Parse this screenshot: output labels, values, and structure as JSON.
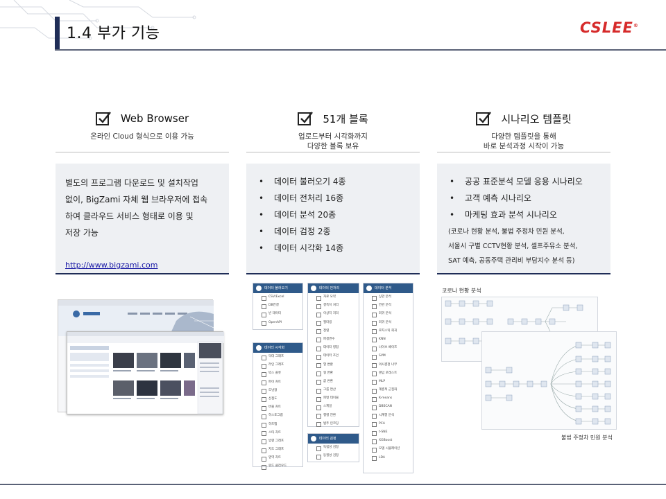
{
  "header": {
    "title": "1.4 부가 기능",
    "logo": "CSLEE",
    "logo_mark": "®"
  },
  "features": [
    {
      "title": "Web Browser",
      "subtitle_lines": [
        "온라인 Cloud 형식으로 이용 가능"
      ],
      "body_lines": [
        "별도의 프로그램 다운로드 및 설치작업",
        "없이, BigZami 자체 웹 브라우저에 접속",
        "하여 클라우드 서비스 형태로 이용 및",
        "저장 가능"
      ],
      "link": "http://www.bigzami.com"
    },
    {
      "title": "51개 블록",
      "subtitle_lines": [
        "업로드부터 시각화까지",
        "다양한 블록 보유"
      ],
      "bullets": [
        "데이터 불러오기 4종",
        "데이터 전처리 16종",
        "데이터 분석 20종",
        "데이터 검정 2종",
        "데이터 시각화 14종"
      ]
    },
    {
      "title": "시나리오 템플릿",
      "subtitle_lines": [
        "다양한 템플릿을 통해",
        "바로 분석과정 시작이 가능"
      ],
      "bullets": [
        "공공 표준분석 모델 응용 시나리오",
        "고객 예측 시나리오",
        "마케팅 효과 분석 시나리오"
      ],
      "note_lines": [
        "(코로나 현황 분석, 불법 주정차 민원 분석,",
        "서울시 구별 CCTV현황 분석, 셀프주유소 분석,",
        "SAT 예측, 공동주택 관리비 부담지수 분석 등)"
      ]
    }
  ],
  "panels": {
    "load": {
      "title": "데이터 불러오기",
      "items": [
        "CSV/Excel",
        "DB연결",
        "빈 데이터",
        "OpenAPI"
      ]
    },
    "viz": {
      "title": "데이터 시각화",
      "items": [
        "막대 그래프",
        "라인 그래프",
        "박스 플롯",
        "파이 차트",
        "도넛형",
        "산점도",
        "버블 차트",
        "히스토그램",
        "히트맵",
        "스타 차트",
        "방향 그래프",
        "지도 그래프",
        "영역 차트",
        "워드 클라우드"
      ]
    },
    "prep": {
      "title": "데이터 전처리",
      "items": [
        "자료 요약",
        "결측치 처리",
        "이상치 처리",
        "필터링",
        "정렬",
        "파생변수",
        "데이터 병합",
        "데이터 조인",
        "열 변환",
        "형 변환",
        "값 변환",
        "그룹 연산",
        "피벗 테이블",
        "스케일",
        "행렬 전환",
        "범주 인코딩"
      ]
    },
    "test": {
      "title": "데이터 검정",
      "items": [
        "독립성 검정",
        "동질성 검정"
      ]
    },
    "anal": {
      "title": "데이터 분석",
      "items": [
        "상관 분석",
        "연관 분석",
        "회귀 분석",
        "회귀 분석",
        "로지스틱 회귀",
        "KNN",
        "나이브 베이즈",
        "SVM",
        "의사결정 나무",
        "랜덤 포레스트",
        "MLP",
        "계층적 군집화",
        "K-means",
        "DBSCAN",
        "시계열 분석",
        "PCA",
        "t-SNE",
        "XGBoost",
        "모델 시뮬레이션",
        "LDA"
      ]
    }
  },
  "captions": {
    "corona": "코로나 현황 분석",
    "parking": "불법 주정차 민원 분석"
  },
  "colors": {
    "accent": "#1f2d57",
    "logo": "#d62a2a",
    "panel_header": "#2f5a8a"
  }
}
